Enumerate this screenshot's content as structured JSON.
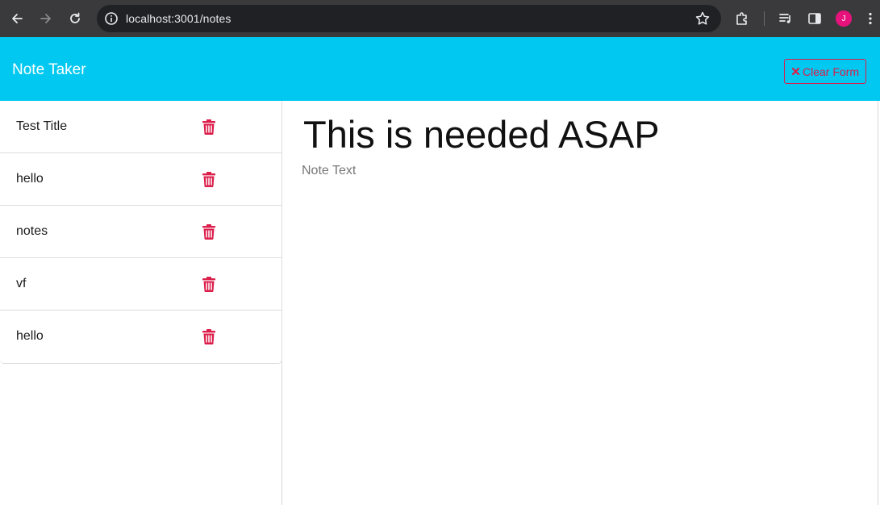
{
  "browser": {
    "url": "localhost:3001/notes",
    "avatar_letter": "J"
  },
  "header": {
    "title": "Note Taker",
    "clear_label": "Clear Form",
    "clear_icon": "x-icon"
  },
  "colors": {
    "header_bg": "#00c8f0",
    "accent_red": "#dc1e4b"
  },
  "notes": [
    {
      "title": "Test Title",
      "icon": "trash-icon"
    },
    {
      "title": "hello",
      "icon": "trash-icon"
    },
    {
      "title": "notes",
      "icon": "trash-icon"
    },
    {
      "title": "vf",
      "icon": "trash-icon"
    },
    {
      "title": "hello",
      "icon": "trash-icon"
    }
  ],
  "editor": {
    "title_value": "This is needed ASAP",
    "text_placeholder": "Note Text"
  }
}
